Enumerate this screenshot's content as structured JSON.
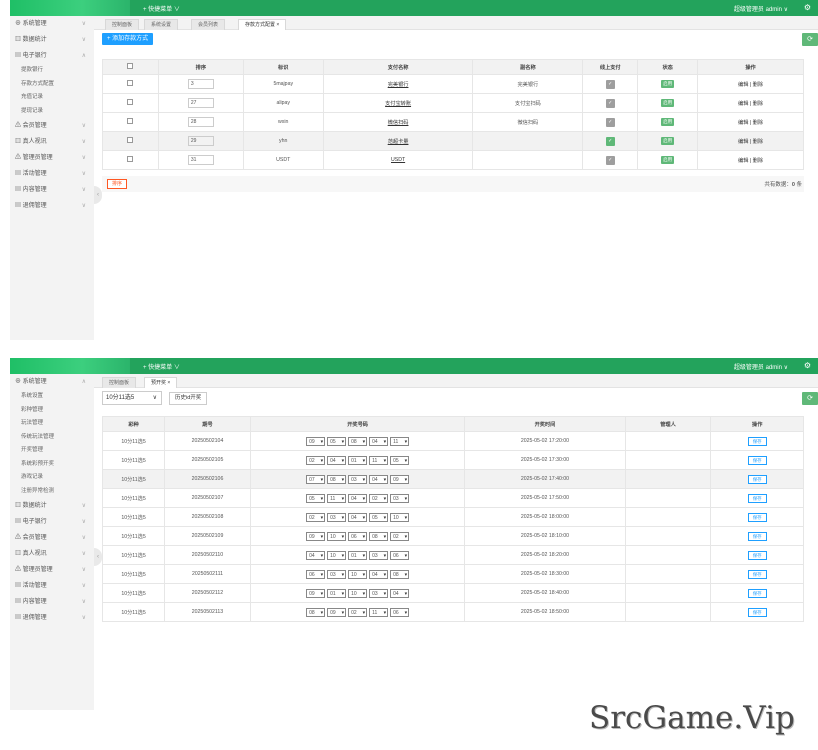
{
  "screen1": {
    "topbar": {
      "quick_menu": "+ 快捷菜单 ∨",
      "admin": "超级管理员  admin ∨"
    },
    "sidebar": {
      "items": [
        {
          "label": "⊕ 系统管理",
          "chev": "∨"
        },
        {
          "label": "▥ 数据统计",
          "chev": "∨"
        },
        {
          "label": "▤ 电子银行",
          "chev": "∧"
        }
      ],
      "sub_items": [
        "提款银行",
        "存款方式配置",
        "充值记录",
        "提现记录"
      ],
      "items_after": [
        {
          "label": "⚠ 会员管理",
          "chev": "∨"
        },
        {
          "label": "▥ 真人视讯",
          "chev": "∨"
        },
        {
          "label": "⚠ 管理员管理",
          "chev": "∨"
        },
        {
          "label": "▤ 活动管理",
          "chev": "∨"
        },
        {
          "label": "▤ 内容管理",
          "chev": "∨"
        },
        {
          "label": "▤ 退佣管理",
          "chev": "∨"
        }
      ]
    },
    "tabs": [
      "控制面板",
      "系统设置",
      "会员列表",
      "存款方式配置 ×"
    ],
    "add_button": "+ 添加存款方式",
    "refresh": "⟳",
    "table": {
      "headers": [
        "",
        "排序",
        "标识",
        "支付名称",
        "副名称",
        "线上支付",
        "状态",
        "操作"
      ],
      "rows": [
        {
          "sort": "3",
          "code": "5majpay",
          "name": "完美银行",
          "subname": "完美银行",
          "status": "启用",
          "ops": "编辑 | 删除"
        },
        {
          "sort": "27",
          "code": "alipay",
          "name": "支付宝转账",
          "subname": "支付宝扫码",
          "status": "启用",
          "ops": "编辑 | 删除"
        },
        {
          "sort": "28",
          "code": "wxin",
          "name": "微信扫码",
          "subname": "微信扫码",
          "status": "启用",
          "ops": "编辑 | 删除"
        },
        {
          "sort": "29",
          "code": "yhn",
          "name": "范超卡量",
          "subname": "",
          "status": "启用",
          "ops": "编辑 | 删除"
        },
        {
          "sort": "31",
          "code": "USDT",
          "name": "USDT",
          "subname": "",
          "status": "启用",
          "ops": "编辑 | 删除"
        }
      ]
    },
    "sort_button": "排序",
    "total_label": "共有数据：",
    "total_value": "0",
    "total_unit": " 条"
  },
  "screen2": {
    "topbar": {
      "quick_menu": "+ 快捷菜单 ∨",
      "admin": "超级管理员  admin ∨"
    },
    "sidebar": {
      "first": {
        "label": "⊕ 系统管理",
        "chev": "∧"
      },
      "sub_items": [
        "系统设置",
        "彩种管理",
        "玩法管理",
        "传统玩法管理",
        "开奖管理",
        "系统彩预开奖",
        "游戏记录",
        "注册异常检测"
      ],
      "items_after": [
        {
          "label": "▥ 数据统计",
          "chev": "∨"
        },
        {
          "label": "▤ 电子银行",
          "chev": "∨"
        },
        {
          "label": "⚠ 会员管理",
          "chev": "∨"
        },
        {
          "label": "▥ 真人视讯",
          "chev": "∨"
        },
        {
          "label": "⚠ 管理员管理",
          "chev": "∨"
        },
        {
          "label": "▤ 活动管理",
          "chev": "∨"
        },
        {
          "label": "▤ 内容管理",
          "chev": "∨"
        },
        {
          "label": "▤ 退佣管理",
          "chev": "∨"
        }
      ]
    },
    "tabs": [
      "控制面板",
      "预开奖 ×"
    ],
    "game_select": "10分11选5",
    "game_select_arrow": "∨",
    "history_button": "历史id开奖",
    "refresh": "⟳",
    "table": {
      "headers": [
        "彩种",
        "期号",
        "开奖号码",
        "开奖时间",
        "管理人",
        "操作"
      ],
      "save_label": "保存",
      "rows": [
        {
          "game": "10分11选5",
          "issue": "20250502104",
          "nums": [
            "09",
            "05",
            "08",
            "04",
            "11"
          ],
          "time": "2025-05-02 17:20:00",
          "manager": ""
        },
        {
          "game": "10分11选5",
          "issue": "20250502105",
          "nums": [
            "02",
            "04",
            "01",
            "11",
            "05"
          ],
          "time": "2025-05-02 17:30:00",
          "manager": ""
        },
        {
          "game": "10分11选5",
          "issue": "20250502106",
          "nums": [
            "07",
            "08",
            "03",
            "04",
            "09"
          ],
          "time": "2025-05-02 17:40:00",
          "manager": ""
        },
        {
          "game": "10分11选5",
          "issue": "20250502107",
          "nums": [
            "05",
            "11",
            "04",
            "02",
            "03"
          ],
          "time": "2025-05-02 17:50:00",
          "manager": ""
        },
        {
          "game": "10分11选5",
          "issue": "20250502108",
          "nums": [
            "02",
            "03",
            "04",
            "05",
            "10"
          ],
          "time": "2025-05-02 18:00:00",
          "manager": ""
        },
        {
          "game": "10分11选5",
          "issue": "20250502109",
          "nums": [
            "09",
            "10",
            "06",
            "08",
            "02"
          ],
          "time": "2025-05-02 18:10:00",
          "manager": ""
        },
        {
          "game": "10分11选5",
          "issue": "20250502110",
          "nums": [
            "04",
            "10",
            "01",
            "03",
            "06"
          ],
          "time": "2025-05-02 18:20:00",
          "manager": ""
        },
        {
          "game": "10分11选5",
          "issue": "20250502111",
          "nums": [
            "06",
            "03",
            "10",
            "04",
            "08"
          ],
          "time": "2025-05-02 18:30:00",
          "manager": ""
        },
        {
          "game": "10分11选5",
          "issue": "20250502112",
          "nums": [
            "09",
            "01",
            "10",
            "03",
            "04"
          ],
          "time": "2025-05-02 18:40:00",
          "manager": ""
        },
        {
          "game": "10分11选5",
          "issue": "20250502113",
          "nums": [
            "08",
            "09",
            "02",
            "11",
            "06"
          ],
          "time": "2025-05-02 18:50:00",
          "manager": ""
        }
      ]
    }
  },
  "watermark": "SrcGame.Vip",
  "icons": {
    "gear": "gear-icon",
    "refresh": "refresh-icon",
    "collapse": "collapse-arrow-icon"
  },
  "colors": {
    "topbar": "#23a35c",
    "accent_green": "#5fb878",
    "accent_blue": "#1e9fff",
    "sort_red": "#ff5722"
  }
}
